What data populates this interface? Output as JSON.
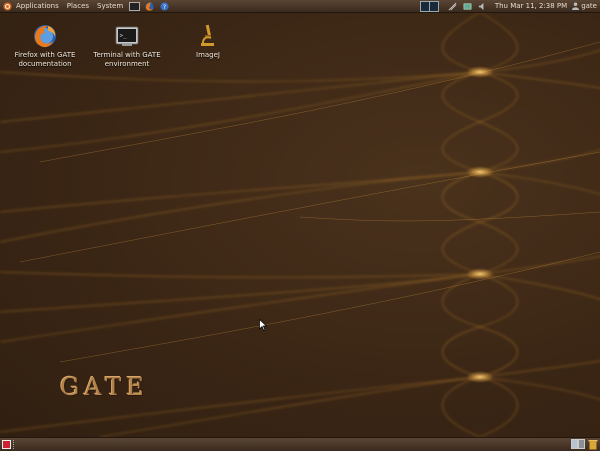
{
  "top_panel": {
    "menus": [
      "Applications",
      "Places",
      "System"
    ],
    "clock": "Thu Mar 11,  2:38 PM",
    "user": "gate"
  },
  "desktop": {
    "icons": [
      {
        "label": "Firefox with GATE documentation"
      },
      {
        "label": "Terminal with GATE environment"
      },
      {
        "label": "ImageJ"
      }
    ],
    "wallpaper_text": "GATE"
  },
  "colors": {
    "panel": "#4a3727",
    "desktop": "#3f2a18",
    "glow": "#e8a23a"
  }
}
